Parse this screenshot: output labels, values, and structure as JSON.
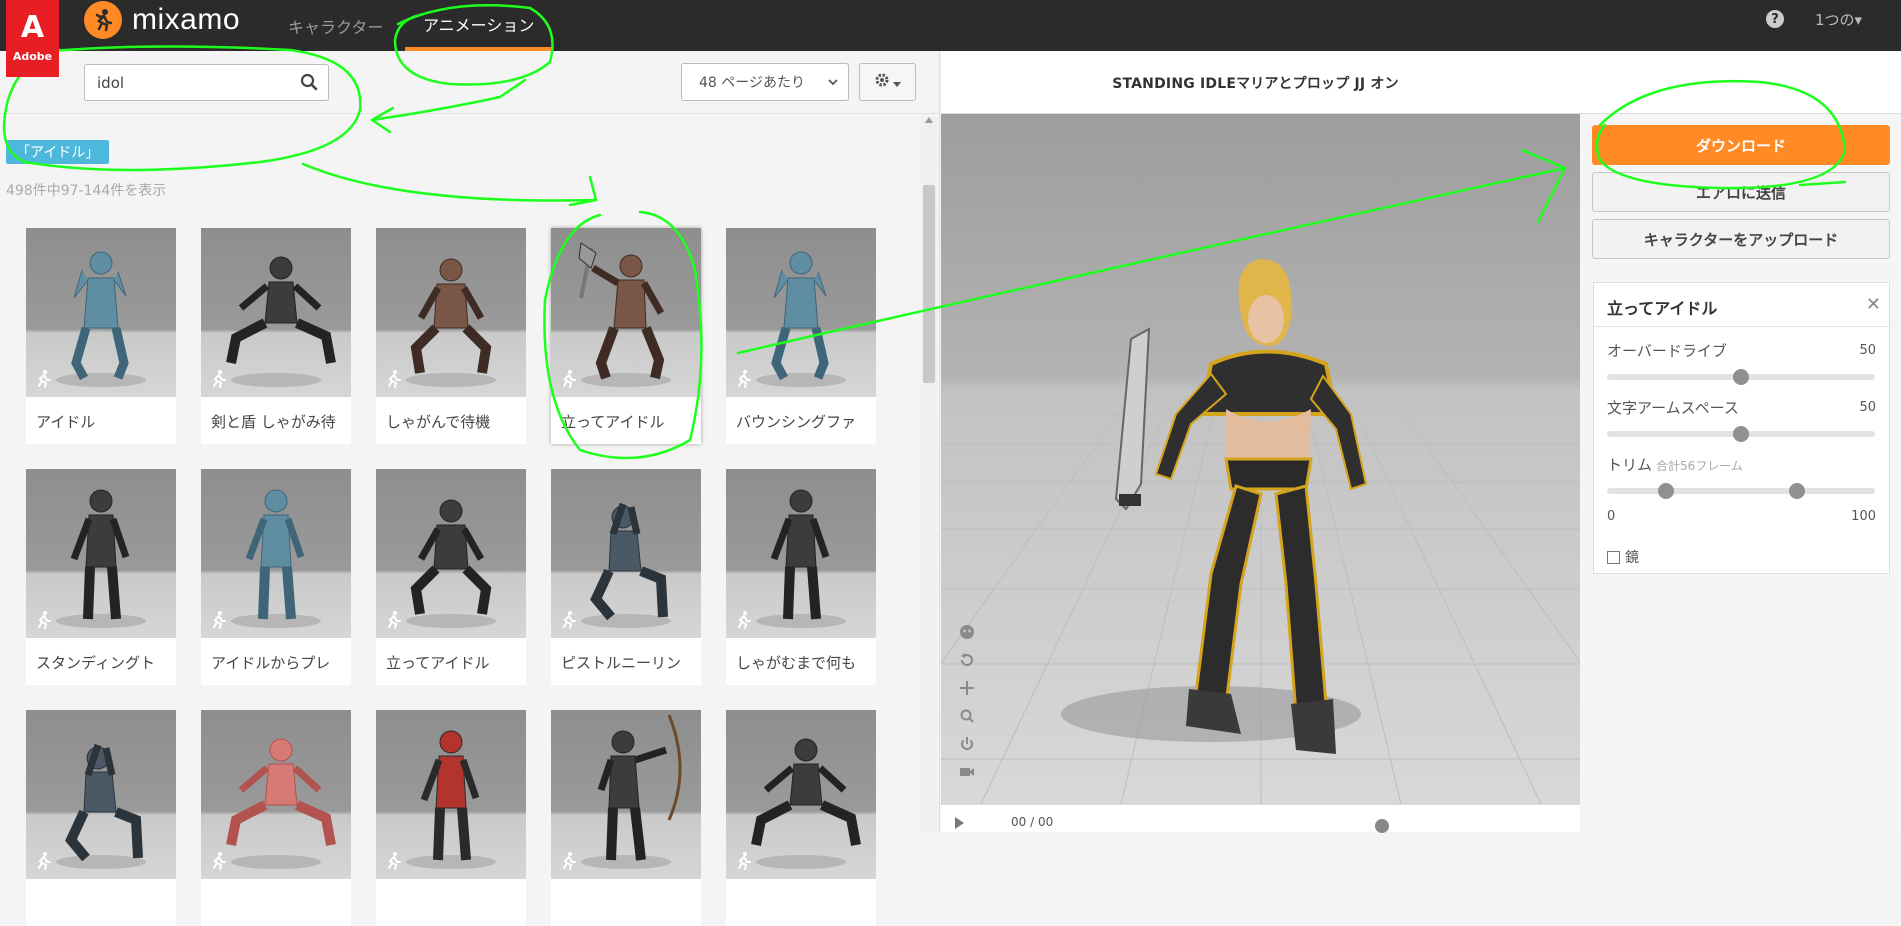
{
  "topbar": {
    "adobe_glyph": "A",
    "adobe_word": "Adobe",
    "brand": "mixamo",
    "tabs": [
      {
        "label": "キャラクター",
        "active": false
      },
      {
        "label": "アニメーション",
        "active": true
      }
    ],
    "help": "?",
    "account": "1つの▾"
  },
  "search": {
    "value": "idol",
    "per_page": "48 ページあたり",
    "tag": "「アイドル」",
    "count": "498件中97-144件を表示"
  },
  "cards": [
    {
      "label": "アイドル",
      "tone": "blue",
      "pose": "guard"
    },
    {
      "label": "剣と盾 しゃがみ待",
      "tone": "dark",
      "pose": "crouch"
    },
    {
      "label": "しゃがんで待機",
      "tone": "brown",
      "pose": "squat"
    },
    {
      "label": "立ってアイドル",
      "tone": "brown",
      "pose": "axe"
    },
    {
      "label": "バウンシングファ",
      "tone": "blue",
      "pose": "guard"
    },
    {
      "label": "スタンディングト",
      "tone": "dark",
      "pose": "stand"
    },
    {
      "label": "アイドルからプレ",
      "tone": "blue",
      "pose": "stand"
    },
    {
      "label": "立ってアイドル",
      "tone": "dark",
      "pose": "squat"
    },
    {
      "label": "ピストルニーリン",
      "tone": "soldier",
      "pose": "kneel"
    },
    {
      "label": "しゃがむまで何も",
      "tone": "dark",
      "pose": "stand"
    },
    {
      "label": "",
      "tone": "soldier",
      "pose": "kneel"
    },
    {
      "label": "",
      "tone": "red",
      "pose": "crouch"
    },
    {
      "label": "",
      "tone": "woman",
      "pose": "stand"
    },
    {
      "label": "",
      "tone": "dark",
      "pose": "bow"
    },
    {
      "label": "",
      "tone": "dark",
      "pose": "crouch"
    }
  ],
  "viewer": {
    "title": "STANDING IDLEマリアとプロップ JJ オン",
    "frame": "00 / 00"
  },
  "actions": {
    "download": "ダウンロード",
    "send_aero": "エアロに送信",
    "upload_character": "キャラクターをアップロード"
  },
  "settings": {
    "title": "立ってアイドル",
    "overdrive_label": "オーバードライブ",
    "overdrive_value": "50",
    "overdrive_level": 0.5,
    "arm_label": "文字アームスペース",
    "arm_value": "50",
    "arm_level": 0.5,
    "trim_label": "トリム",
    "trim_note": "合計56フレーム",
    "trim_start": 0.22,
    "trim_end": 0.71,
    "trim_min": "0",
    "trim_max": "100",
    "mirror_label": "鏡"
  },
  "colors": {
    "accent": "#ff8a26",
    "annotation": "#1dff1d",
    "tag": "#4db8dc"
  }
}
